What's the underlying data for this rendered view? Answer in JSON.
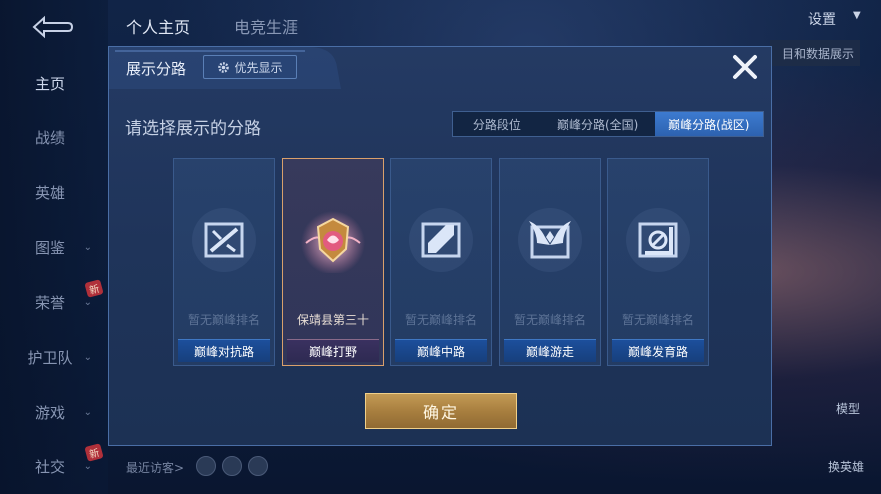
{
  "nav": {
    "tabs": [
      "个人主页",
      "电竞生涯"
    ],
    "settings_label": "设置",
    "right_button_label": "目和数据展示"
  },
  "sidebar": {
    "items": [
      {
        "label": "主页",
        "chevron": false,
        "active": true
      },
      {
        "label": "战绩",
        "chevron": false
      },
      {
        "label": "英雄",
        "chevron": false
      },
      {
        "label": "图鉴",
        "chevron": true
      },
      {
        "label": "荣誉",
        "chevron": true
      },
      {
        "label": "护卫队",
        "chevron": true
      },
      {
        "label": "游戏",
        "chevron": true
      },
      {
        "label": "社交",
        "chevron": true
      }
    ],
    "new_badge": "新"
  },
  "footer": {
    "recent_visitors_label": "最近访客>",
    "right_labels": [
      "模型",
      "换英雄"
    ]
  },
  "dialog": {
    "title": "展示分路",
    "priority_button": "优先显示",
    "close_icon": "close-icon",
    "prompt": "请选择展示的分路",
    "segments": [
      {
        "label": "分路段位",
        "active": false
      },
      {
        "label": "巅峰分路(全国)",
        "active": false
      },
      {
        "label": "巅峰分路(战区)",
        "active": true
      }
    ],
    "cards": [
      {
        "rank": "暂无巅峰排名",
        "lane": "巅峰对抗路",
        "selected": false,
        "icon": "clash-lane-icon"
      },
      {
        "rank": "保靖县第三十",
        "lane": "巅峰打野",
        "selected": true,
        "icon": "jungle-emblem-icon"
      },
      {
        "rank": "暂无巅峰排名",
        "lane": "巅峰中路",
        "selected": false,
        "icon": "mid-lane-icon"
      },
      {
        "rank": "暂无巅峰排名",
        "lane": "巅峰游走",
        "selected": false,
        "icon": "roam-wings-icon"
      },
      {
        "rank": "暂无巅峰排名",
        "lane": "巅峰发育路",
        "selected": false,
        "icon": "farm-lane-icon"
      }
    ],
    "confirm_label": "确定"
  },
  "colors": {
    "accent_blue": "#2d62b0",
    "confirm_gold": "#a87f3f",
    "selected_border": "#d9a06b"
  }
}
